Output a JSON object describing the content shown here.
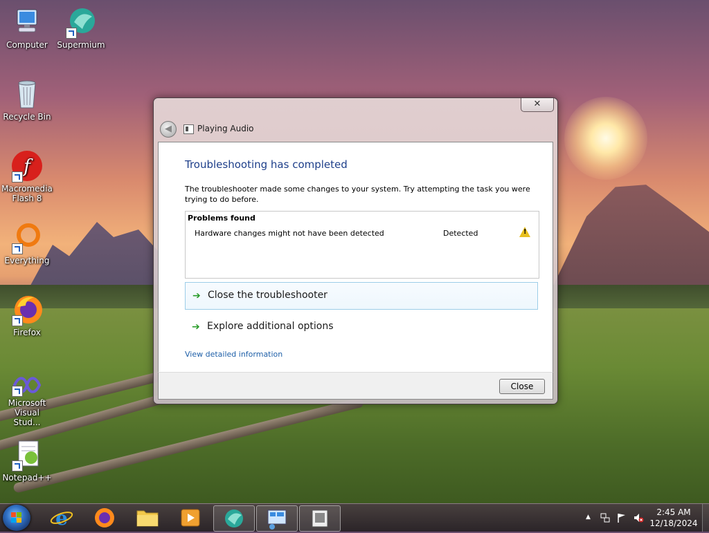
{
  "desktop": {
    "icons": [
      {
        "label": "Computer"
      },
      {
        "label": "Supermium"
      },
      {
        "label": "Recycle Bin"
      },
      {
        "label": "Macromedia Flash 8"
      },
      {
        "label": "Everything"
      },
      {
        "label": "Firefox"
      },
      {
        "label": "Microsoft Visual Stud..."
      },
      {
        "label": "Notepad++"
      }
    ]
  },
  "window": {
    "close_glyph": "✕",
    "back_glyph": "◀",
    "title": "Playing Audio",
    "heading": "Troubleshooting has completed",
    "description": "The troubleshooter made some changes to your system. Try attempting the task you were trying to do before.",
    "problems": {
      "header": "Problems found",
      "rows": [
        {
          "name": "Hardware changes might not have been detected",
          "status": "Detected",
          "icon": "warning-icon"
        }
      ]
    },
    "options": [
      {
        "label": "Close the troubleshooter",
        "arrow": "➔"
      },
      {
        "label": "Explore additional options",
        "arrow": "➔"
      }
    ],
    "detail_link": "View detailed information",
    "footer_button": "Close"
  },
  "taskbar": {
    "tray_glyphs": {
      "chevron": "▲"
    },
    "time": "2:45 AM",
    "date": "12/18/2024"
  },
  "colors": {
    "heading": "#1e3f8a",
    "link": "#1e5fa8",
    "arrow": "#2a9c2a",
    "warning": "#e8c020"
  }
}
